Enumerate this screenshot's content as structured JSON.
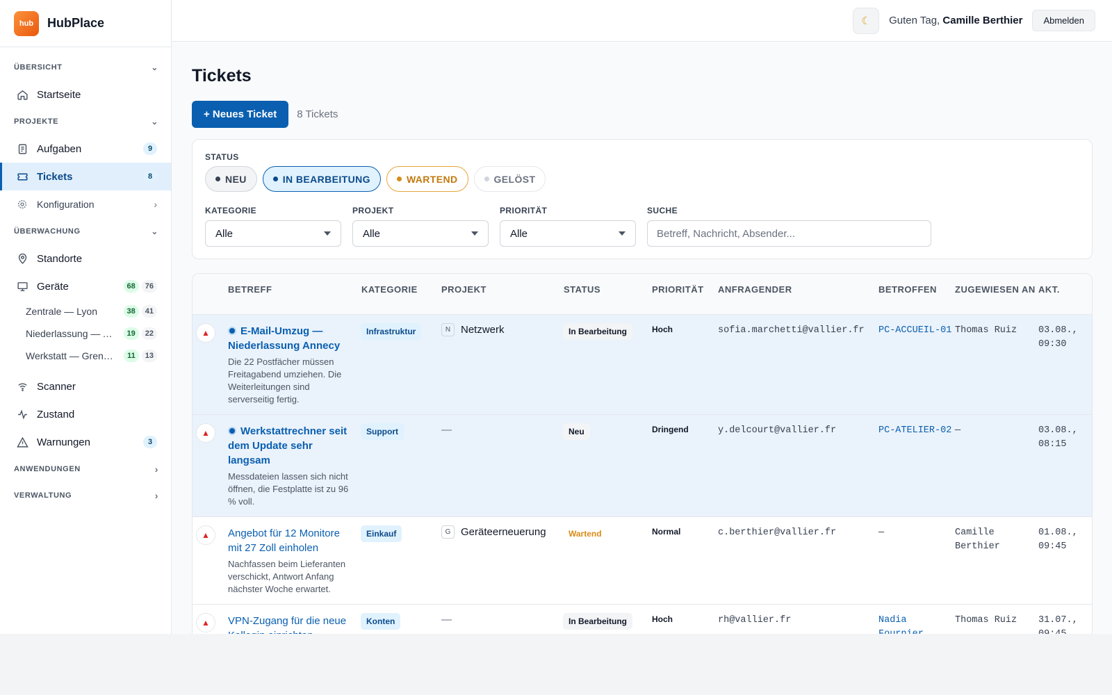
{
  "app": {
    "logo_text": "hub",
    "name": "HubPlace"
  },
  "header": {
    "theme_icon": "moon-icon",
    "greeting": "Guten Tag,",
    "user": "Camille Berthier",
    "logout": "Abmelden"
  },
  "sidebar": {
    "sec_overview": "ÜBERSICHT",
    "home": "Startseite",
    "sec_projects": "PROJEKTE",
    "tasks": {
      "label": "Aufgaben",
      "count": "9"
    },
    "tickets": {
      "label": "Tickets",
      "count": "8"
    },
    "config": "Konfiguration",
    "sec_monitoring": "ÜBERWACHUNG",
    "locations": "Standorte",
    "devices": {
      "label": "Geräte",
      "online": "68",
      "total": "76"
    },
    "sites": [
      {
        "label": "Zentrale — Lyon",
        "online": "38",
        "total": "41"
      },
      {
        "label": "Niederlassung — Annecy",
        "online": "19",
        "total": "22"
      },
      {
        "label": "Werkstatt — Grenoble",
        "online": "11",
        "total": "13"
      }
    ],
    "scanner": "Scanner",
    "health": "Zustand",
    "warnings": {
      "label": "Warnungen",
      "count": "3"
    },
    "sec_apps": "ANWENDUNGEN",
    "sec_admin": "VERWALTUNG"
  },
  "page": {
    "title": "Tickets",
    "new_button": "+ Neues Ticket",
    "count": "8 Tickets"
  },
  "filters": {
    "status_label": "STATUS",
    "chips": [
      "NEU",
      "IN BEARBEITUNG",
      "WARTEND",
      "GELÖST"
    ],
    "category": {
      "label": "KATEGORIE",
      "value": "Alle"
    },
    "project": {
      "label": "PROJEKT",
      "value": "Alle"
    },
    "priority": {
      "label": "PRIORITÄT",
      "value": "Alle"
    },
    "search": {
      "label": "SUCHE",
      "placeholder": "Betreff, Nachricht, Absender..."
    }
  },
  "table": {
    "headers": [
      "BETREFF",
      "KATEGORIE",
      "PROJEKT",
      "STATUS",
      "PRIORITÄT",
      "ANFRAGENDER",
      "BETROFFEN",
      "ZUGEWIESEN AN",
      "AKT."
    ],
    "rows": [
      {
        "subject": "E-Mail-Umzug — Niederlassung Annecy",
        "description": "Die 22 Postfächer müssen Freitagabend umziehen. Die Weiterleitungen sind serverseitig fertig.",
        "category": "Infrastruktur",
        "project_initial": "N",
        "project": "Netzwerk",
        "status": "In Bearbeitung",
        "priority": "Hoch",
        "requester": "sofia.marchetti@vallier.fr",
        "affected": "PC-ACCUEIL-01",
        "assignee": "Thomas Ruiz",
        "updated": "03.08., 09:30"
      },
      {
        "subject": "Werkstattrechner seit dem Update sehr langsam",
        "description": "Messdateien lassen sich nicht öffnen, die Festplatte ist zu 96 % voll.",
        "category": "Support",
        "project": "—",
        "status": "Neu",
        "priority": "Dringend",
        "requester": "y.delcourt@vallier.fr",
        "affected": "PC-ATELIER-02",
        "assignee": "—",
        "updated": "03.08., 08:15"
      },
      {
        "subject": "Angebot für 12 Monitore mit 27 Zoll einholen",
        "description": "Nachfassen beim Lieferanten verschickt, Antwort Anfang nächster Woche erwartet.",
        "category": "Einkauf",
        "project_initial": "G",
        "project": "Geräteerneuerung",
        "status": "Wartend",
        "priority": "Normal",
        "requester": "c.berthier@vallier.fr",
        "affected": "—",
        "assignee": "Camille Berthier",
        "updated": "01.08., 09:45"
      },
      {
        "subject": "VPN-Zugang für die neue Kollegin einrichten",
        "category": "Konten",
        "project": "—",
        "status": "In Bearbeitung",
        "priority": "Hoch",
        "requester": "rh@vallier.fr",
        "affected": "Nadia Fournier",
        "assignee": "Thomas Ruiz",
        "updated": "31.07., 09:45"
      }
    ]
  }
}
